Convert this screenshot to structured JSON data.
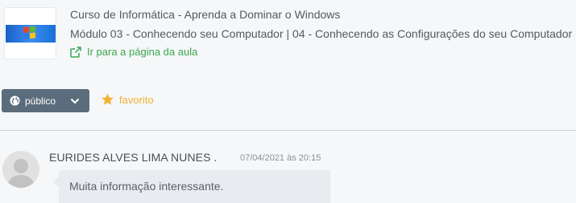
{
  "course": {
    "title": "Curso de Informática - Aprenda a Dominar o Windows",
    "module": "Módulo 03 - Conhecendo seu Computador | 04 - Conhecendo as Configurações do seu Computador",
    "link_label": "Ir para a página da aula",
    "thumb_icon": "windows-logo-icon"
  },
  "actions": {
    "visibility_label": "público",
    "visibility_icon": "globe-icon",
    "favorite_label": "favorito",
    "favorite_icon": "star-icon"
  },
  "comment": {
    "author": "EURIDES ALVES LIMA NUNES .",
    "date": "07/04/2021 às 20:15",
    "text": "Muita informação interessante."
  },
  "colors": {
    "link_green": "#3aa64d",
    "button_slate": "#5b6d7c",
    "favorite_yellow": "#f0b331",
    "bubble_bg": "#e8ecf0",
    "page_bg": "#f5f7f9"
  }
}
